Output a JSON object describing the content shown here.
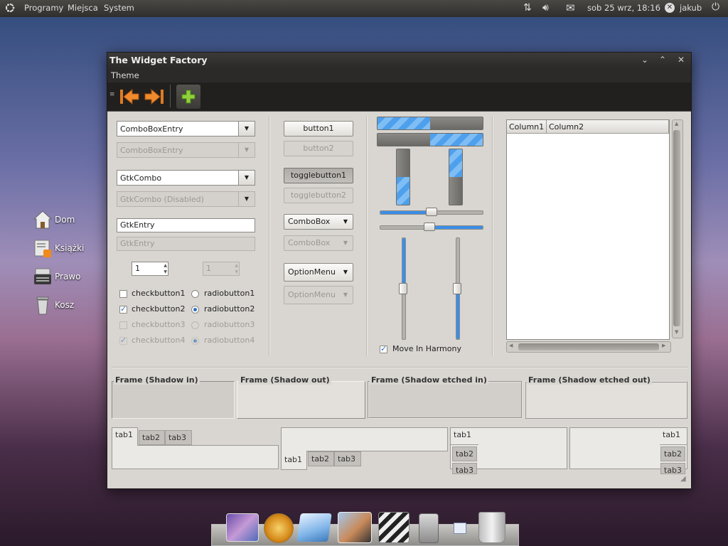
{
  "panel": {
    "menus": [
      "Programy",
      "Miejsca",
      "System"
    ],
    "clock": "sob 25 wrz, 18:16",
    "user": "jakub"
  },
  "desktop": {
    "icons": [
      {
        "label": "Dom",
        "icon": "home-icon"
      },
      {
        "label": "Książki",
        "icon": "books-icon"
      },
      {
        "label": "Prawo",
        "icon": "typewriter-icon"
      },
      {
        "label": "Kosz",
        "icon": "trash-icon"
      }
    ]
  },
  "window": {
    "title": "The Widget Factory",
    "menu": [
      "Theme"
    ],
    "toolbar": [
      "back-icon",
      "forward-icon",
      "add-icon"
    ]
  },
  "col1": {
    "comboboxentry": "ComboBoxEntry",
    "comboboxentry_disabled": "ComboBoxEntry",
    "gtkcombo": "GtkCombo",
    "gtkcombo_disabled": "GtkCombo (Disabled)",
    "entry": "GtkEntry",
    "entry_disabled": "GtkEntry",
    "spin": "1",
    "spin_disabled": "1",
    "checkbuttons": [
      {
        "label": "checkbutton1",
        "checked": false,
        "disabled": false
      },
      {
        "label": "checkbutton2",
        "checked": true,
        "disabled": false
      },
      {
        "label": "checkbutton3",
        "checked": false,
        "disabled": true
      },
      {
        "label": "checkbutton4",
        "checked": true,
        "disabled": true
      }
    ],
    "radiobuttons": [
      {
        "label": "radiobutton1",
        "checked": false,
        "disabled": false
      },
      {
        "label": "radiobutton2",
        "checked": true,
        "disabled": false
      },
      {
        "label": "radiobutton3",
        "checked": false,
        "disabled": true
      },
      {
        "label": "radiobutton4",
        "checked": true,
        "disabled": true
      }
    ]
  },
  "col2": {
    "button1": "button1",
    "button2": "button2",
    "toggle1": "togglebutton1",
    "toggle2": "togglebutton2",
    "combobox": "ComboBox",
    "combobox_disabled": "ComboBox",
    "optionmenu": "OptionMenu",
    "optionmenu_disabled": "OptionMenu"
  },
  "col3": {
    "progress_h": [
      0.5,
      0.5
    ],
    "progress_v": [
      0.5,
      0.5
    ],
    "hscale": [
      0.5,
      0.48
    ],
    "vscale": [
      0.5,
      0.5
    ],
    "harmony_label": "Move In Harmony",
    "harmony_checked": true
  },
  "tree": {
    "columns": [
      "Column1",
      "Column2"
    ]
  },
  "frames": [
    {
      "label": "Frame (Shadow in)"
    },
    {
      "label": "Frame (Shadow out)"
    },
    {
      "label": "Frame (Shadow etched in)"
    },
    {
      "label": "Frame (Shadow etched out)"
    }
  ],
  "notebooks": {
    "tabs": [
      "tab1",
      "tab2",
      "tab3"
    ]
  },
  "colors": {
    "accent": "#3b8ee6",
    "window_bg": "#d9d6d1",
    "titlebar": "#2b2a28"
  }
}
